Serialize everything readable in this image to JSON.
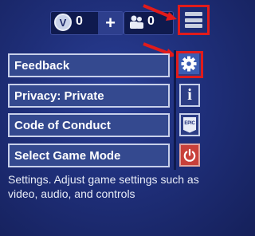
{
  "currency": {
    "vbucks_icon_glyph": "V",
    "vbucks_count": "0",
    "plus_label": "+",
    "friends_count": "0"
  },
  "menu": {
    "items": [
      {
        "label": "Feedback"
      },
      {
        "label": "Privacy: Private"
      },
      {
        "label": "Code of Conduct"
      },
      {
        "label": "Select Game Mode"
      }
    ]
  },
  "side_buttons": {
    "settings_icon": "gear-icon",
    "info_label": "i",
    "epic_label": "EPIC",
    "power_icon": "power-icon"
  },
  "description": "Settings. Adjust game settings such as video, audio, and controls",
  "colors": {
    "highlight": "#e11b1b",
    "button_bg": "#34498f",
    "background": "#1f2f7a",
    "power": "#c8403a"
  }
}
